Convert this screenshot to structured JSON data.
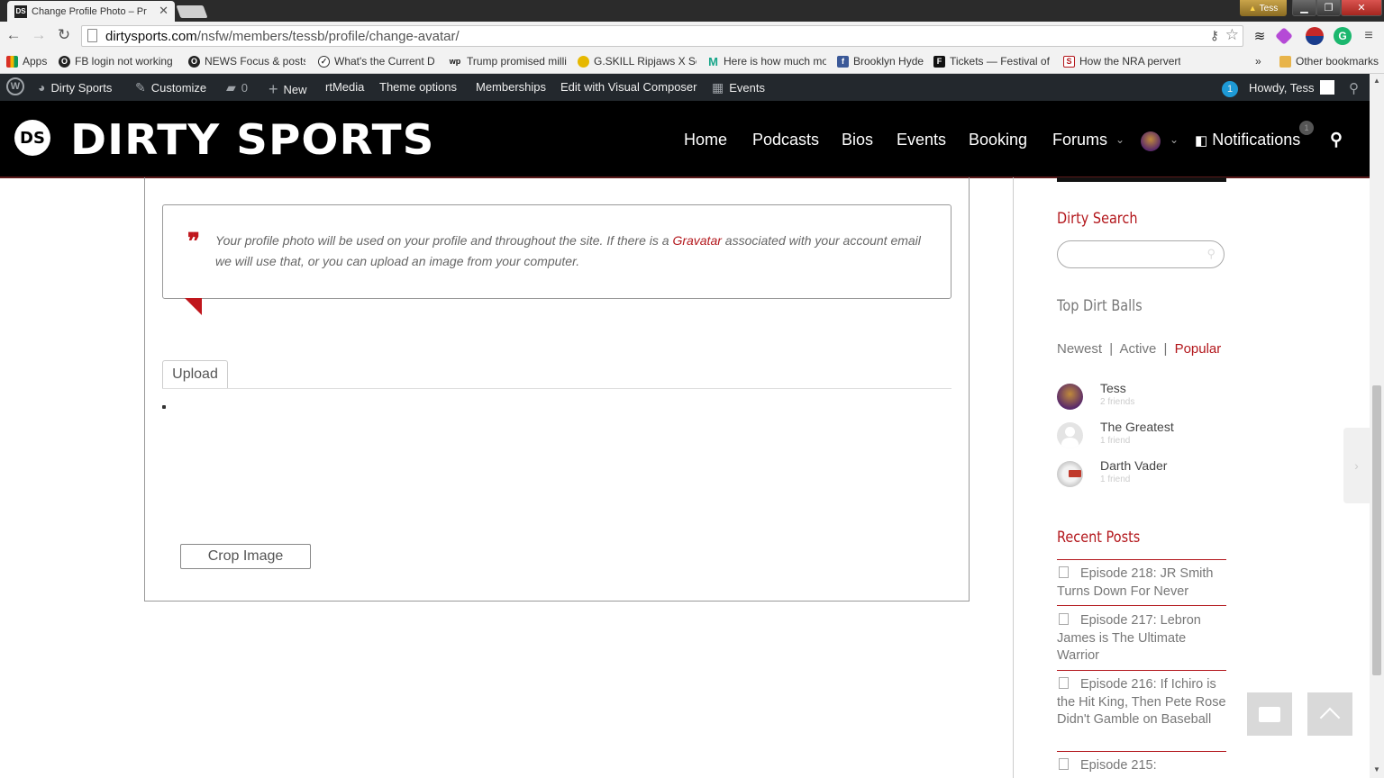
{
  "browser": {
    "tab_title": "Change Profile Photo – Pr",
    "tab_favicon": "DS",
    "profile_name": "Tess",
    "url_host": "dirtysports.com",
    "url_path": "/nsfw/members/tessb/profile/change-avatar/"
  },
  "bookmarks": [
    {
      "label": "Apps",
      "icon": "apps-icon",
      "color": "#d93025"
    },
    {
      "label": "FB login not working",
      "icon": "globe-icon",
      "color": "#222"
    },
    {
      "label": "NEWS Focus & posts",
      "icon": "globe-icon",
      "color": "#222"
    },
    {
      "label": "What's the Current D",
      "icon": "clock-icon",
      "color": "#fff"
    },
    {
      "label": "Trump promised milli",
      "icon": "wp-icon",
      "color": "#fff"
    },
    {
      "label": "G.SKILL Ripjaws X Seri",
      "icon": "gskill-icon",
      "color": "#e6b800"
    },
    {
      "label": "Here is how much mo",
      "icon": "m-icon",
      "color": "#17a589"
    },
    {
      "label": "Brooklyn Hyde",
      "icon": "facebook-icon",
      "color": "#3b5998"
    },
    {
      "label": "Tickets — Festival of",
      "icon": "tickets-icon",
      "color": "#111"
    },
    {
      "label": "How the NRA pervert",
      "icon": "slate-icon",
      "color": "#b3171c"
    },
    {
      "label": "»",
      "icon": "more-icon",
      "color": "#fff"
    },
    {
      "label": "Other bookmarks",
      "icon": "folder-icon",
      "color": "#e8b44a"
    }
  ],
  "adminbar": {
    "site_name": "Dirty Sports",
    "customize": "Customize",
    "comments_count": "0",
    "new": "New",
    "rtmedia": "rtMedia",
    "theme_options": "Theme options",
    "memberships": "Memberships",
    "visual_composer": "Edit with Visual Composer",
    "events": "Events",
    "notification_count": "1",
    "howdy": "Howdy, Tess"
  },
  "header": {
    "logo_mark": "DS",
    "logo_text": "DIRTY SPORTS",
    "nav": {
      "home": "Home",
      "podcasts": "Podcasts",
      "bios": "Bios",
      "events": "Events",
      "booking": "Booking",
      "forums": "Forums",
      "notifications": "Notifications",
      "notifications_badge": "1"
    }
  },
  "main": {
    "quote_before_link": "Your profile photo will be used on your profile and throughout the site. If there is a ",
    "quote_link": "Gravatar",
    "quote_after_link": " associated with your account email we will use that, or you can upload an image from your computer.",
    "upload_tab": "Upload",
    "crop_button": "Crop Image"
  },
  "sidebar": {
    "search_title": "Dirty Search",
    "members_title": "Top Dirt Balls",
    "tab_newest": "Newest",
    "tab_active": "Active",
    "tab_popular": "Popular",
    "separator": "|",
    "members": [
      {
        "name": "Tess",
        "friends": "2 friends"
      },
      {
        "name": "The Greatest",
        "friends": "1 friend"
      },
      {
        "name": "Darth Vader",
        "friends": "1 friend"
      }
    ],
    "recent_title": "Recent Posts",
    "posts": [
      "Episode 218: JR Smith Turns Down For Never",
      "Episode 217: Lebron James is The Ultimate Warrior",
      "Episode 216: If Ichiro is the Hit King, Then Pete Rose Didn't Gamble on Baseball",
      "Episode 215:"
    ]
  },
  "colors": {
    "accent_red": "#b3171c",
    "header_bg": "#000000",
    "adminbar_bg": "#23282d"
  }
}
